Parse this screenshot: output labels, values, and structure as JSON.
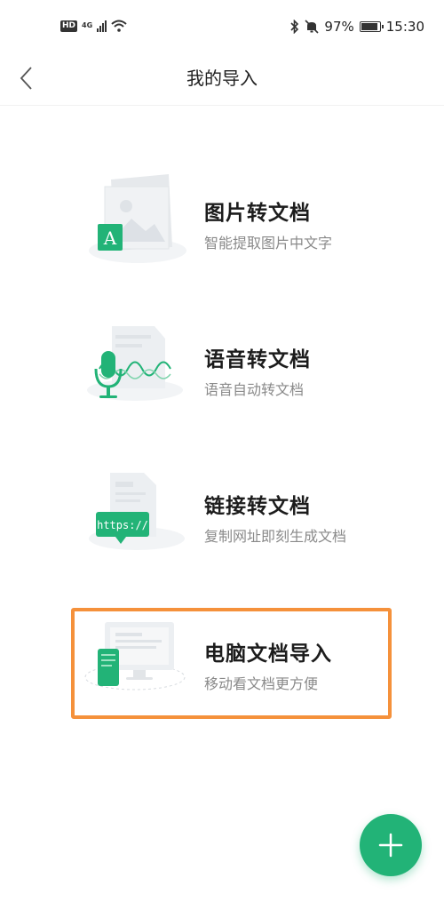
{
  "status_bar": {
    "hd": "HD",
    "network": "4G",
    "battery_text": "97%",
    "battery_level": 0.97,
    "time": "15:30",
    "icons": [
      "signal-icon",
      "wifi-icon",
      "bluetooth-icon",
      "mute-icon",
      "battery-icon"
    ]
  },
  "header": {
    "title": "我的导入",
    "back_icon": "chevron-left-icon"
  },
  "options": [
    {
      "title": "图片转文档",
      "subtitle": "智能提取图片中文字",
      "badge": "A"
    },
    {
      "title": "语音转文档",
      "subtitle": "语音自动转文档"
    },
    {
      "title": "链接转文档",
      "subtitle": "复制网址即刻生成文档",
      "badge": "https://"
    },
    {
      "title": "电脑文档导入",
      "subtitle": "移动看文档更方便"
    }
  ],
  "fab": {
    "icon": "plus-icon"
  },
  "colors": {
    "accent": "#22b377",
    "highlight": "#f5913b"
  }
}
